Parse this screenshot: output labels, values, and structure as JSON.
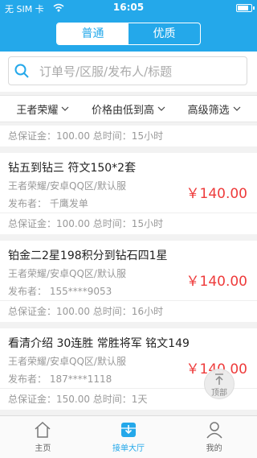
{
  "status": {
    "carrier": "无 SIM 卡",
    "time": "16:05",
    "battery_level": 0.8
  },
  "segment": {
    "tab1": "普通",
    "tab2": "优质"
  },
  "search": {
    "placeholder": "订单号/区服/发布人/标题"
  },
  "filters": [
    {
      "label": "王者荣耀"
    },
    {
      "label": "价格由低到高"
    },
    {
      "label": "高级筛选"
    }
  ],
  "top_partial": {
    "line": "总保证金：100.00  总时间：15小时"
  },
  "orders": [
    {
      "title": "钻五到钻三    符文150*2套",
      "server": "王者荣耀/安卓QQ区/默认服",
      "publisher": "发布者：  千鹰发单",
      "price": "￥140.00",
      "bottom": "总保证金：100.00  总时间：15小时"
    },
    {
      "title": "铂金二2星198积分到钻石四1星",
      "server": "王者荣耀/安卓QQ区/默认服",
      "publisher": "发布者：  155****9053",
      "price": "￥140.00",
      "bottom": "总保证金：100.00  总时间：16小时"
    },
    {
      "title": "看清介绍 30连胜 常胜将军 铭文149",
      "server": "王者荣耀/安卓QQ区/默认服",
      "publisher": "发布者：  187****1118",
      "price": "￥140.00",
      "bottom": "总保证金：150.00  总时间：1天"
    }
  ],
  "back_to_top": "顶部",
  "tabbar": [
    {
      "label": "主页",
      "icon": "home-icon"
    },
    {
      "label": "接单大厅",
      "icon": "order-hall-icon"
    },
    {
      "label": "我的",
      "icon": "person-icon"
    }
  ],
  "colors": {
    "primary": "#24a8ea",
    "price": "#ee3b3b"
  }
}
